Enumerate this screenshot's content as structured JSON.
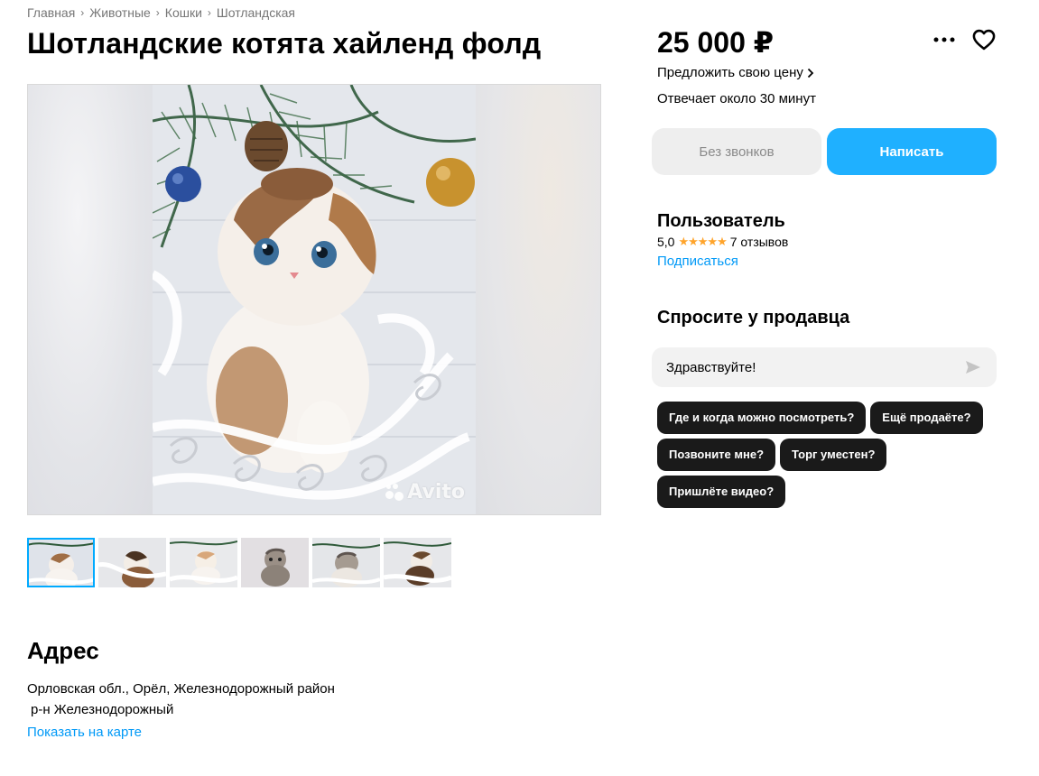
{
  "breadcrumb": [
    "Главная",
    "Животные",
    "Кошки",
    "Шотландская"
  ],
  "title": "Шотландские котята хайленд фолд",
  "gallery": {
    "watermark": "Avito",
    "thumbnail_count": 6,
    "active_thumbnail": 1
  },
  "price": "25 000 ₽",
  "offer_price_link": "Предложить свою цену",
  "reply_time": "Отвечает около 30 минут",
  "buttons": {
    "no_calls": "Без звонков",
    "write": "Написать"
  },
  "seller": {
    "name": "Пользователь",
    "rating": "5,0",
    "stars": "★★★★★",
    "reviews": "7 отзывов",
    "subscribe": "Подписаться"
  },
  "ask": {
    "title": "Спросите у продавца",
    "message_value": "Здравствуйте!",
    "chips": [
      "Где и когда можно посмотреть?",
      "Ещё продаёте?",
      "Позвоните мне?",
      "Торг уместен?",
      "Пришлёте видео?"
    ]
  },
  "address": {
    "title": "Адрес",
    "line1": "Орловская обл., Орёл, Железнодорожный район",
    "line2": "р-н Железнодорожный",
    "map_link": "Показать на карте"
  },
  "colors": {
    "accent": "#1fb0ff",
    "link": "#0099f7",
    "star": "#ffa42b",
    "chip_bg": "#1a1a1a"
  }
}
